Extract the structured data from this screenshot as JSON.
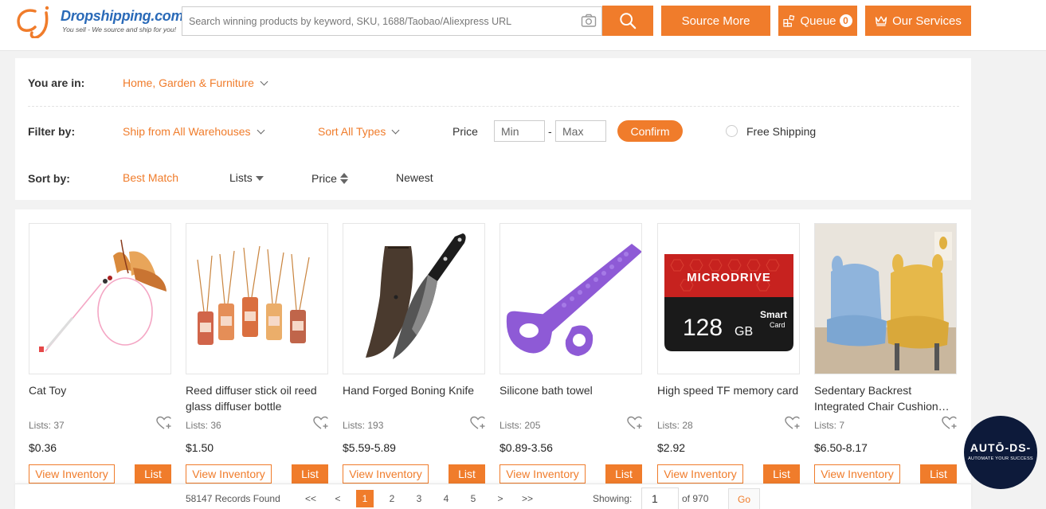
{
  "header": {
    "logo_name": "Dropshipping.com",
    "logo_tagline": "You sell - We source and ship for you!",
    "search_placeholder": "Search winning products by keyword, SKU, 1688/Taobao/Aliexpress URL",
    "source_more_label": "Source More",
    "queue_label": "Queue",
    "queue_count": "0",
    "services_label": "Our Services",
    "accent_color": "#f07c2b"
  },
  "filters": {
    "you_are_in_label": "You are in:",
    "category": "Home, Garden & Furniture",
    "filter_by_label": "Filter by:",
    "warehouse": "Ship from All Warehouses",
    "type": "Sort All Types",
    "price_label": "Price",
    "price_min_placeholder": "Min",
    "price_separator": "-",
    "price_max_placeholder": "Max",
    "confirm_label": "Confirm",
    "free_shipping_label": "Free Shipping",
    "sort_by_label": "Sort by:",
    "sort_options": [
      "Best Match",
      "Lists",
      "Price",
      "Newest"
    ],
    "active_sort": "Best Match"
  },
  "products": [
    {
      "name": "Cat Toy",
      "lists": "Lists: 37",
      "price": "$0.36",
      "view_label": "View Inventory",
      "list_label": "List"
    },
    {
      "name": "Reed diffuser stick oil reed glass diffuser bottle",
      "lists": "Lists: 36",
      "price": "$1.50",
      "view_label": "View Inventory",
      "list_label": "List"
    },
    {
      "name": "Hand Forged Boning Knife",
      "lists": "Lists: 193",
      "price": "$5.59-5.89",
      "view_label": "View Inventory",
      "list_label": "List"
    },
    {
      "name": "Silicone bath towel",
      "lists": "Lists: 205",
      "price": "$0.89-3.56",
      "view_label": "View Inventory",
      "list_label": "List"
    },
    {
      "name": "High speed TF memory card",
      "lists": "Lists: 28",
      "price": "$2.92",
      "view_label": "View Inventory",
      "list_label": "List"
    },
    {
      "name": "Sedentary Backrest Integrated Chair Cushion Bear Seat",
      "lists": "Lists: 7",
      "price": "$6.50-8.17",
      "view_label": "View Inventory",
      "list_label": "List"
    }
  ],
  "memory_card": {
    "brand": "MICRODRIVE",
    "capacity": "128",
    "unit": "GB",
    "label1": "Smart",
    "label2": "Card"
  },
  "pagination": {
    "records": "58147 Records Found",
    "first": "<<",
    "prev": "<",
    "pages": [
      "1",
      "2",
      "3",
      "4",
      "5"
    ],
    "current": "1",
    "next": ">",
    "last": ">>",
    "showing_label": "Showing:",
    "page_value": "1",
    "total": "of 970",
    "go_label": "Go"
  },
  "badge": {
    "logo": "AUTŌ-DS-",
    "tagline": "AUTOMATE YOUR SUCCESS"
  }
}
